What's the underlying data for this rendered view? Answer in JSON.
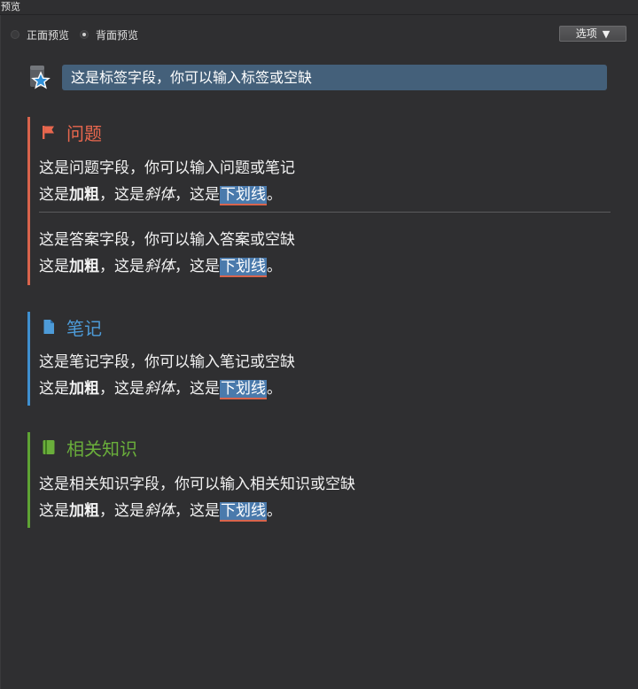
{
  "window": {
    "title": "预览"
  },
  "toolbar": {
    "front_preview": "正面预览",
    "back_preview": "背面预览",
    "selected": "back",
    "options_label": "选项",
    "options_caret": "▼"
  },
  "tags": {
    "text": "这是标签字段，你可以输入标签或空缺"
  },
  "question": {
    "heading": "问题",
    "line1": "这是问题字段，你可以输入问题或笔记",
    "answer_line1": "这是答案字段，你可以输入答案或空缺"
  },
  "note": {
    "heading": "笔记",
    "line1": "这是笔记字段，你可以输入笔记或空缺"
  },
  "related": {
    "heading": "相关知识",
    "line1": "这是相关知识字段，你可以输入相关知识或空缺"
  },
  "format_sample": {
    "prefix": "这是",
    "bold": "加粗",
    "mid1": "，这是",
    "italic": "斜体",
    "mid2": "，这是",
    "underline": "下划线",
    "suffix": "。"
  },
  "colors": {
    "question_accent": "#d9644c",
    "note_accent": "#3f8fcf",
    "related_accent": "#5ea334",
    "tag_field_bg": "#44607a",
    "highlight_bg": "#4a7aac"
  }
}
